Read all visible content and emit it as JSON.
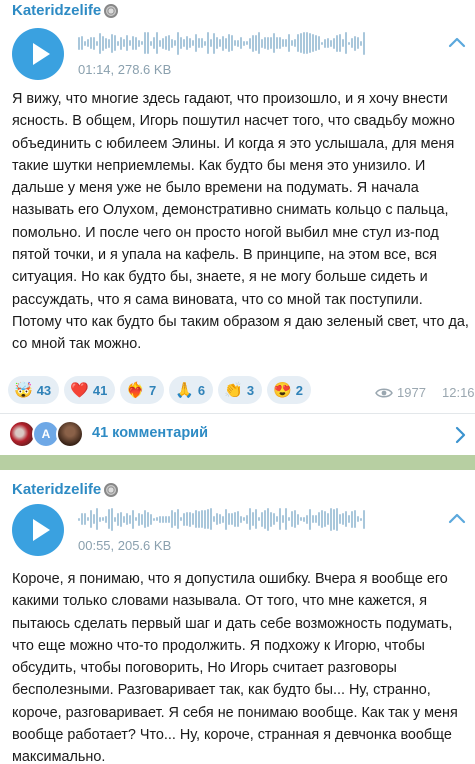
{
  "posts": [
    {
      "channel": "Kateridzelife",
      "voice": {
        "meta": "01:14, 278.6 KB"
      },
      "text": "Я вижу, что многие здесь гадают, что произошло, и я хочу внести ясность. В общем, Игорь пошутил насчет того, что свадьбу можно объединить с юбилеем Элины. И когда я это услышала, для меня такие шутки неприемлемы. Как будто бы меня это унизило. И дальше у меня уже не было времени на подумать. Я начала называть его Олухом, демонстративно снимать кольцо с пальца, помольно. И после чего он просто ногой выбил мне стул из-под пятой точки, и я упала на кафель. В принципе, на этом все, вся ситуация. Но как будто бы, знаете, я не могу больше сидеть и рассуждать, что я сама виновата, что со мной так поступили. Потому что как будто бы таким образом я даю зеленый свет, что да, со мной так можно.",
      "reactions": [
        {
          "emoji": "🤯",
          "icon": "exploding-head-icon",
          "count": "43"
        },
        {
          "emoji": "❤️",
          "icon": "heart-icon",
          "count": "41"
        },
        {
          "emoji": "❤️‍🔥",
          "icon": "heart-on-fire-icon",
          "count": "7"
        },
        {
          "emoji": "🙏",
          "icon": "folded-hands-icon",
          "count": "6"
        },
        {
          "emoji": "👏",
          "icon": "clapping-hands-icon",
          "count": "3"
        },
        {
          "emoji": "😍",
          "icon": "heart-eyes-icon",
          "count": "2"
        }
      ],
      "views": "1977",
      "time": "12:16",
      "comments": {
        "avatar_letter": "A",
        "label": "41 комментарий"
      }
    },
    {
      "channel": "Kateridzelife",
      "voice": {
        "meta": "00:55, 205.6 KB"
      },
      "text": "Короче, я понимаю, что я допустила ошибку. Вчера я вообще его какими только словами называла. От того, что мне кажется, я пытаюсь сделать первый шаг и дать себе возможность подумать, что еще можно что-то продолжить. Я подхожу к Игорю, чтобы обсудить, чтобы поговорить, Но Игорь считает разговоры бесполезными. Разговаривает так, как будто бы... Ну, странно, короче, разговаривает. Я себя не понимаю вообще. Как так у меня вообще работает? Что... Ну, короче, странная я девчонка вообще максимально."
    }
  ],
  "colors": {
    "accent": "#2e8bc4",
    "play_button": "#3aa1e0",
    "reaction_bg": "#e6eef5",
    "background": "#c5d7b8"
  }
}
